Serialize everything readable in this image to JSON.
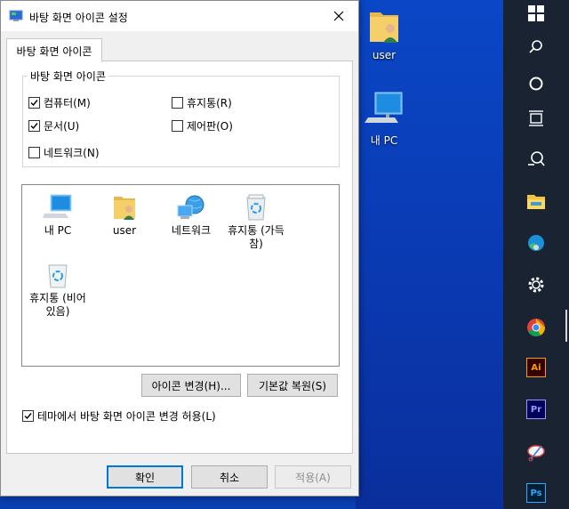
{
  "dialog": {
    "title": "바탕 화면 아이콘 설정",
    "tab": "바탕 화면 아이콘",
    "group_label": "바탕 화면 아이콘",
    "checkboxes": [
      {
        "label": "컴퓨터(M)",
        "checked": true
      },
      {
        "label": "휴지통(R)",
        "checked": false
      },
      {
        "label": "문서(U)",
        "checked": true
      },
      {
        "label": "제어판(O)",
        "checked": false
      },
      {
        "label": "네트워크(N)",
        "checked": false
      }
    ],
    "icons": [
      {
        "label": "내 PC",
        "icon": "computer-icon"
      },
      {
        "label": "user",
        "icon": "user-folder-icon"
      },
      {
        "label": "네트워크",
        "icon": "network-icon"
      },
      {
        "label": "휴지통 (가득 참)",
        "icon": "recycle-bin-full-icon"
      },
      {
        "label": "휴지통 (비어 있음)",
        "icon": "recycle-bin-empty-icon"
      }
    ],
    "change_icon_button": "아이콘 변경(H)...",
    "restore_default_button": "기본값 복원(S)",
    "allow_theme_label": "테마에서 바탕 화면 아이콘 변경 허용(L)",
    "allow_theme_checked": true,
    "ok_button": "확인",
    "cancel_button": "취소",
    "apply_button": "적용(A)"
  },
  "desktop": {
    "icons": [
      {
        "label": "user",
        "icon": "user-folder-icon"
      },
      {
        "label": "내 PC",
        "icon": "computer-icon"
      }
    ]
  },
  "taskbar": {
    "items": [
      {
        "name": "start-icon"
      },
      {
        "name": "search-icon"
      },
      {
        "name": "cortana-icon"
      },
      {
        "name": "task-view-icon"
      },
      {
        "name": "quick-assist-icon"
      },
      {
        "name": "file-explorer-icon"
      },
      {
        "name": "edge-icon"
      },
      {
        "name": "settings-icon"
      },
      {
        "name": "chrome-icon"
      },
      {
        "name": "illustrator-icon",
        "text": "Ai"
      },
      {
        "name": "premiere-icon",
        "text": "Pr"
      },
      {
        "name": "snipping-tool-icon"
      },
      {
        "name": "photoshop-icon",
        "text": "Ps"
      }
    ]
  },
  "colors": {
    "accent": "#0078d7",
    "desktop": "#0a3fb0",
    "taskbar": "#1a2331",
    "illustrator": "#ff9a00",
    "premiere": "#9999ff",
    "photoshop": "#31a8ff"
  }
}
